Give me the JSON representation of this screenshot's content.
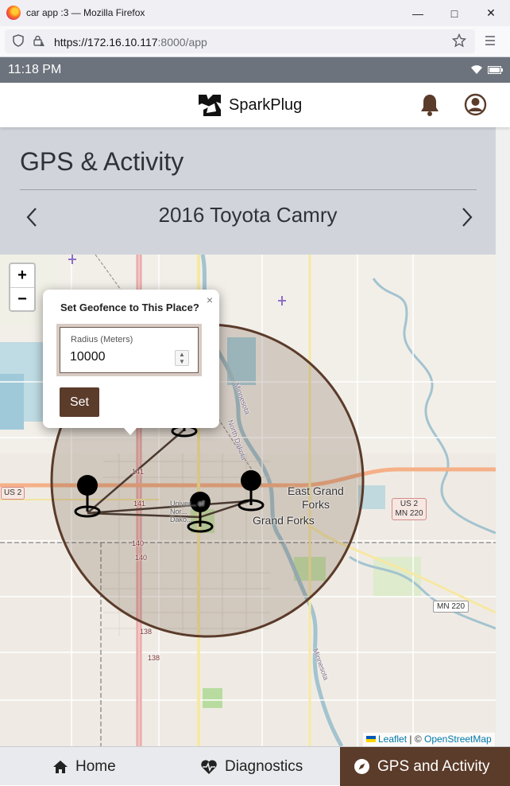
{
  "browser": {
    "window_title": "car app :3 — Mozilla Firefox",
    "url_host": "https://172.16.10.117",
    "url_rest": ":8000/app"
  },
  "status_bar": {
    "time": "11:18 PM"
  },
  "app": {
    "brand": "SparkPlug"
  },
  "gps": {
    "title": "GPS & Activity",
    "vehicle": "2016 Toyota Camry"
  },
  "map": {
    "zoom_in": "+",
    "zoom_out": "−",
    "popup": {
      "question": "Set Geofence to This Place?",
      "close": "×",
      "radius_label": "Radius (Meters)",
      "radius_value": "10000",
      "set_button": "Set"
    },
    "labels": {
      "east_grand_forks_1": "East Grand",
      "east_grand_forks_2": "Forks",
      "grand_forks": "Grand Forks",
      "north_dakota": "North Dakota",
      "minnesota_river": "Minnesota",
      "univ": "Univer... of Nor... Dako..."
    },
    "shields": {
      "us2_left": "US 2",
      "us2_right": "US 2",
      "mn220_right": "MN 220",
      "mn220_low": "MN 220",
      "r141a": "141",
      "r141b": "141",
      "r140a": "140",
      "r140b": "140",
      "r138a": "138",
      "r138b": "138"
    },
    "attribution": {
      "leaflet": "Leaflet",
      "separator": " | © ",
      "osm": "OpenStreetMap"
    }
  },
  "nav": {
    "home": "Home",
    "diagnostics": "Diagnostics",
    "gps_activity": "GPS and Activity"
  },
  "colors": {
    "accent": "#5b3b2a",
    "header_bg": "#d1d5db",
    "status_bar": "#6c737c"
  }
}
